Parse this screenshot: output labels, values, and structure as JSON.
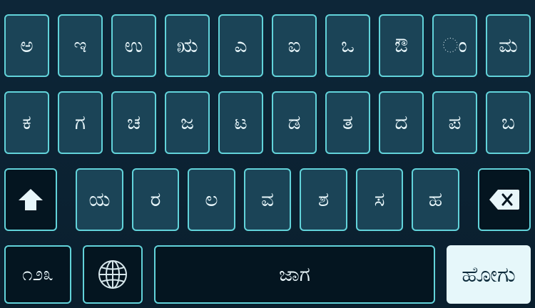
{
  "keyboard": {
    "row1": [
      "ಅ",
      "ಇ",
      "ಉ",
      "ಋ",
      "ಎ",
      "ಐ",
      "ಒ",
      "ಔ",
      "ಂ",
      "ಮ"
    ],
    "row2": [
      "ಕ",
      "ಗ",
      "ಚ",
      "ಜ",
      "ಟ",
      "ಡ",
      "ತ",
      "ದ",
      "ಪ",
      "ಬ"
    ],
    "row3": [
      "ಯ",
      "ರ",
      "ಲ",
      "ವ",
      "ಶ",
      "ಸ",
      "ಹ"
    ],
    "numbers_label": "೧೨೩",
    "space_label": "ಜಾಗ",
    "enter_label": "ಹೋಗು",
    "icons": {
      "shift": "shift-arrow-icon",
      "backspace": "backspace-icon",
      "language": "globe-icon"
    },
    "colors": {
      "key_fill": "#1b4457",
      "key_border": "#62d3da",
      "dark_key_fill": "#041520",
      "enter_fill": "#e6f7fa",
      "background": "#0b2233"
    }
  }
}
